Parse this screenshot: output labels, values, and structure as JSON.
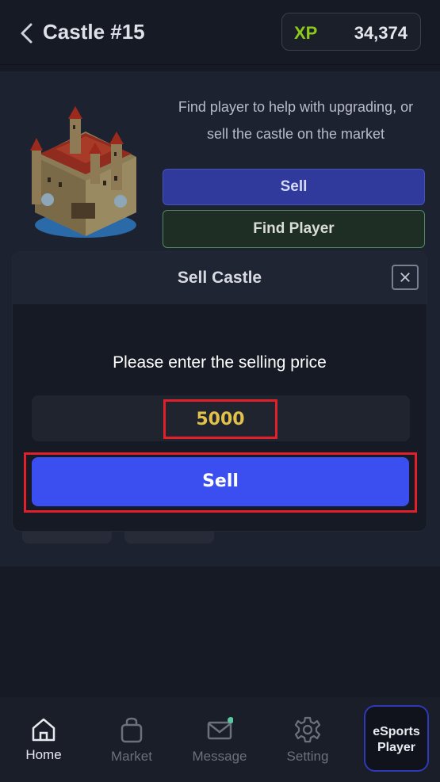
{
  "header": {
    "title": "Castle #15",
    "xp_label": "XP",
    "xp_value": "34,374"
  },
  "castle": {
    "description_line1": "Find player to help with upgrading, or",
    "description_line2": "sell the castle on the market",
    "sell_label": "Sell",
    "find_player_label": "Find Player"
  },
  "modal": {
    "title": "Sell Castle",
    "prompt": "Please enter the selling price",
    "price_value": "5000",
    "sell_label": "Sell"
  },
  "tabbar": {
    "items": [
      {
        "label": "Home",
        "icon": "home-icon"
      },
      {
        "label": "Market",
        "icon": "shopping-bag-icon"
      },
      {
        "label": "Message",
        "icon": "envelope-icon"
      },
      {
        "label": "Setting",
        "icon": "gear-icon"
      }
    ],
    "esports_line1": "eSports",
    "esports_line2": "Player"
  },
  "colors": {
    "accent": "#3b4ff1",
    "xp": "#8cc919",
    "price": "#e2c14a",
    "highlight": "#e0202a"
  }
}
